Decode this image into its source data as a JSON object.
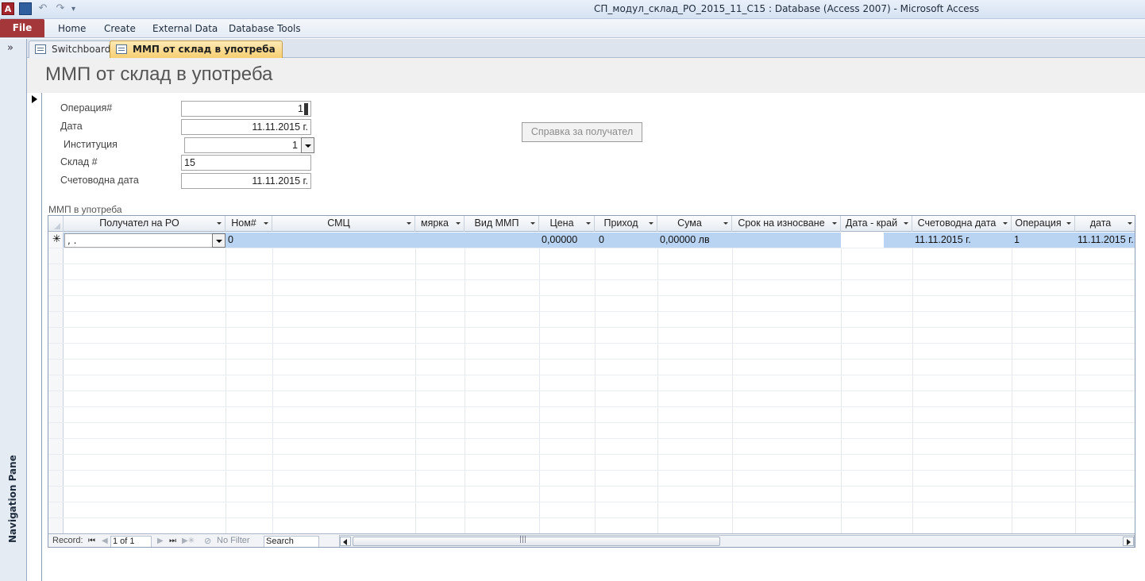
{
  "window": {
    "title": "СП_модул_склад_РО_2015_11_С15 : Database (Access 2007)  -  Microsoft Access",
    "app_letter": "A"
  },
  "ribbon": {
    "file": "File",
    "tabs": [
      "Home",
      "Create",
      "External Data",
      "Database Tools"
    ]
  },
  "nav_pane": {
    "label": "Navigation Pane",
    "toggle": "»"
  },
  "doc_tabs": {
    "switchboard": "Switchboard",
    "active": "ММП от склад в употреба"
  },
  "form": {
    "title": "ММП от склад в употреба",
    "labels": {
      "operation": "Операция#",
      "date": "Дата",
      "institution": "Институция",
      "warehouse": "Склад #",
      "acc_date": "Счетоводна дата"
    },
    "values": {
      "operation": "1",
      "date": "11.11.2015 г.",
      "institution": "1",
      "warehouse": "15",
      "acc_date": "11.11.2015 г."
    },
    "report_button": "Справка за получател"
  },
  "subform": {
    "label": "ММП в употреба",
    "columns": [
      "Получател на РО",
      "Ном#",
      "СМЦ",
      "мярка",
      "Вид ММП",
      "Цена",
      "Приход",
      "Сума",
      "Срок на износване",
      "Дата - край",
      "Счетоводна дата",
      "Операция",
      "дата"
    ],
    "new_row": {
      "recipient": ", .",
      "num": "0",
      "price": "0,00000",
      "income": "0",
      "sum": "0,00000 лв",
      "acc_date": "11.11.2015 г.",
      "operation": "1",
      "date": "11.11.2015 г."
    },
    "navbar": {
      "record_label": "Record:",
      "record_value": "1 of 1",
      "filter": "No Filter",
      "search": "Search"
    }
  },
  "colors": {
    "accent_file": "#a4373a",
    "active_tab": "#f7cf72",
    "new_row": "#b9d4f3"
  }
}
